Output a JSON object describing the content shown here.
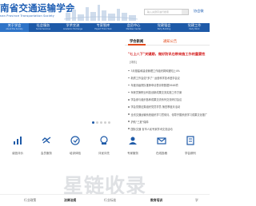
{
  "header": {
    "logo_cn": "南省交通运输学会",
    "logo_en": "nan Province Transportation Society",
    "search_placeholder": "输入关键字进行搜索",
    "head_link": "协会微"
  },
  "nav": [
    {
      "cn": "关于学会",
      "en": "About the Society"
    },
    {
      "cn": "社会服务",
      "en": "Social Services"
    },
    {
      "cn": "学术交流",
      "en": "Academic Exchange"
    },
    {
      "cn": "专家智库",
      "en": "Expert Think Tank"
    },
    {
      "cn": "会员中心",
      "en": "Member Center"
    },
    {
      "cn": "党建强会",
      "en": "Party Building"
    },
    {
      "cn": "党建工作",
      "en": "Party Work"
    }
  ],
  "news": {
    "tab_active": "学会新闻",
    "tab_other": "通知公告",
    "headline": "\"七上八下\"关键期，做好防讯也带来施工作的重要性",
    "badge": "[详情]",
    "items": [
      "3月基建和建设管理工作组织周转通知上4%",
      "新质工作会如\"多了\" 运营科学技术盛享会议",
      "年度省级院队推荐申请表评获数据3648项",
      "驾驶员第职业科技创新成果交流实施工作方案",
      "学会参与组织各种成果交流系列交流研讨会议",
      "学会党委征集组织党员学员 第四季度月活动",
      "全省交通运输系统组织学习贯彻月、领导开展系统学习成果文化推广",
      "护航\"三夏\"保障",
      "国际交通 省市人民专家学术交流活动",
      "驻村帮扶活动 第六届省智慧交通发展大会"
    ]
  },
  "carousel": {
    "active_index": 0,
    "count": 5
  },
  "quick_links": [
    {
      "label": "诚信评价",
      "icon": "chart-icon"
    },
    {
      "label": "会员服务",
      "icon": "handshake-icon"
    },
    {
      "label": "培训体验",
      "icon": "book-icon"
    },
    {
      "label": "评优评先",
      "icon": "medal-icon"
    },
    {
      "label": "专家服务",
      "icon": "expert-icon"
    },
    {
      "label": "在线投稿",
      "icon": "mail-icon"
    },
    {
      "label": "学会期刊",
      "icon": "journal-icon"
    }
  ],
  "watermark": "星链收录",
  "footer": [
    {
      "label": "行业政策",
      "strong": false
    },
    {
      "label": "法律法规",
      "strong": true
    },
    {
      "label": "行业标准",
      "strong": false
    },
    {
      "label": "教育培训",
      "strong": true
    },
    {
      "label": "学",
      "strong": false
    }
  ],
  "colors": {
    "brand_blue": "#1e5aa8",
    "headline_red": "#d42020",
    "accent_orange": "#e24a1b"
  }
}
